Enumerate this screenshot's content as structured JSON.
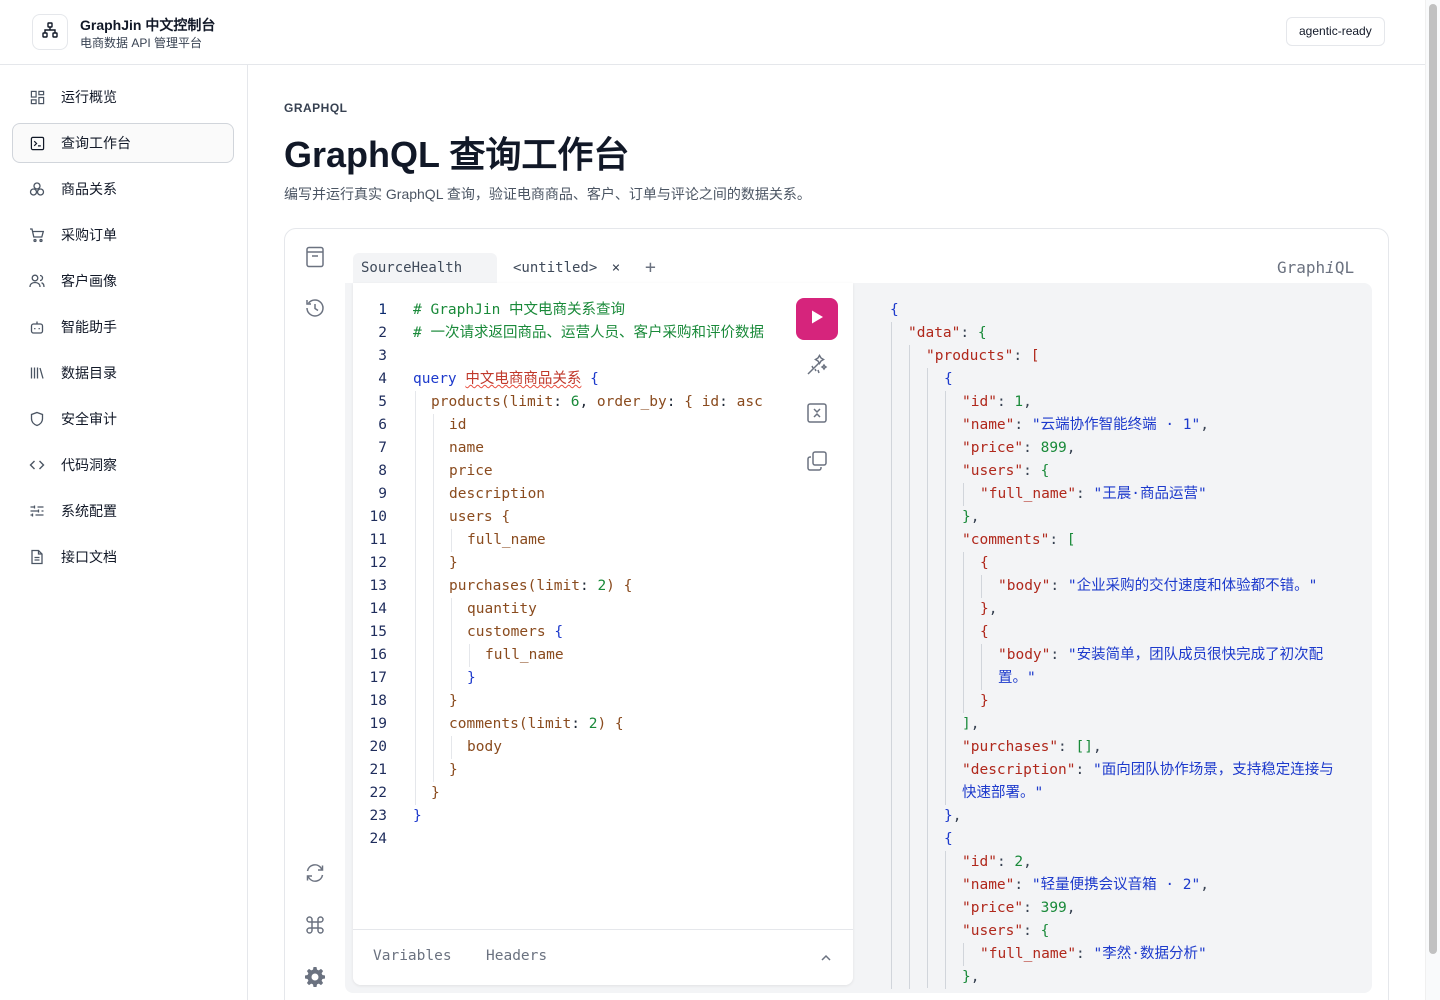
{
  "header": {
    "app_title": "GraphJin 中文控制台",
    "app_subtitle": "电商数据 API 管理平台",
    "badge": "agentic-ready"
  },
  "sidebar": {
    "items": [
      {
        "label": "运行概览",
        "icon": "dashboard-icon"
      },
      {
        "label": "查询工作台",
        "icon": "terminal-icon",
        "active": true
      },
      {
        "label": "商品关系",
        "icon": "relations-icon"
      },
      {
        "label": "采购订单",
        "icon": "cart-icon"
      },
      {
        "label": "客户画像",
        "icon": "users-icon"
      },
      {
        "label": "智能助手",
        "icon": "bot-icon"
      },
      {
        "label": "数据目录",
        "icon": "library-icon"
      },
      {
        "label": "安全审计",
        "icon": "shield-icon"
      },
      {
        "label": "代码洞察",
        "icon": "code-icon"
      },
      {
        "label": "系统配置",
        "icon": "sliders-icon"
      },
      {
        "label": "接口文档",
        "icon": "document-icon"
      }
    ]
  },
  "main": {
    "eyebrow": "GRAPHQL",
    "title": "GraphQL 查询工作台",
    "description": "编写并运行真实 GraphQL 查询，验证电商商品、客户、订单与评论之间的数据关系。"
  },
  "graphiql": {
    "tabs": [
      {
        "label": "SourceHealth",
        "active": true
      },
      {
        "label": "<untitled>",
        "closable": true
      }
    ],
    "add_tab": "+",
    "close_glyph": "×",
    "logo_prefix": "Graph",
    "logo_italic": "i",
    "logo_suffix": "QL",
    "footer_tabs": [
      "Variables",
      "Headers"
    ],
    "line_numbers": [
      "1",
      "2",
      "3",
      "4",
      "5",
      "6",
      "7",
      "8",
      "9",
      "10",
      "11",
      "12",
      "13",
      "14",
      "15",
      "16",
      "17",
      "18",
      "19",
      "20",
      "21",
      "22",
      "23",
      "24"
    ],
    "query": {
      "comment1": "# GraphJin 中文电商关系查询",
      "comment2": "# 一次请求返回商品、运营人员、客户采购和评价数据",
      "keyword": "query",
      "operation_name": "中文电商商品关系",
      "products_field": "products",
      "limit_arg": "limit",
      "limit_products": "6",
      "order_by_arg": "order_by",
      "id_arg": "id",
      "asc_value": "asc",
      "fields": [
        "id",
        "name",
        "price",
        "description",
        "users",
        "full_name",
        "purchases",
        "quantity",
        "customers",
        "comments",
        "body"
      ],
      "limit_sub": "2"
    },
    "result": {
      "data_key": "data",
      "products_key": "products",
      "id_key": "id",
      "name_key": "name",
      "price_key": "price",
      "users_key": "users",
      "full_name_key": "full_name",
      "comments_key": "comments",
      "body_key": "body",
      "purchases_key": "purchases",
      "description_key": "description",
      "p1_id": "1",
      "p1_name": "云端协作智能终端 · 1",
      "p1_price": "899",
      "p1_user": "王晨·商品运营",
      "p1_comment1": "企业采购的交付速度和体验都不错。",
      "p1_comment2a": "安装简单，团队成员很快完成了初次配",
      "p1_comment2b": "置。",
      "p1_desc_a": "面向团队协作场景，支持稳定连接与",
      "p1_desc_b": "快速部署。",
      "p2_id": "2",
      "p2_name": "轻量便携会议音箱 · 2",
      "p2_price": "399",
      "p2_user": "李然·数据分析"
    }
  },
  "colors": {
    "run_button": "#d6247c",
    "json_key": "#b0281c",
    "json_string": "#1d3acc",
    "json_number": "#1a8a3a",
    "comment": "#1a8a3a"
  }
}
